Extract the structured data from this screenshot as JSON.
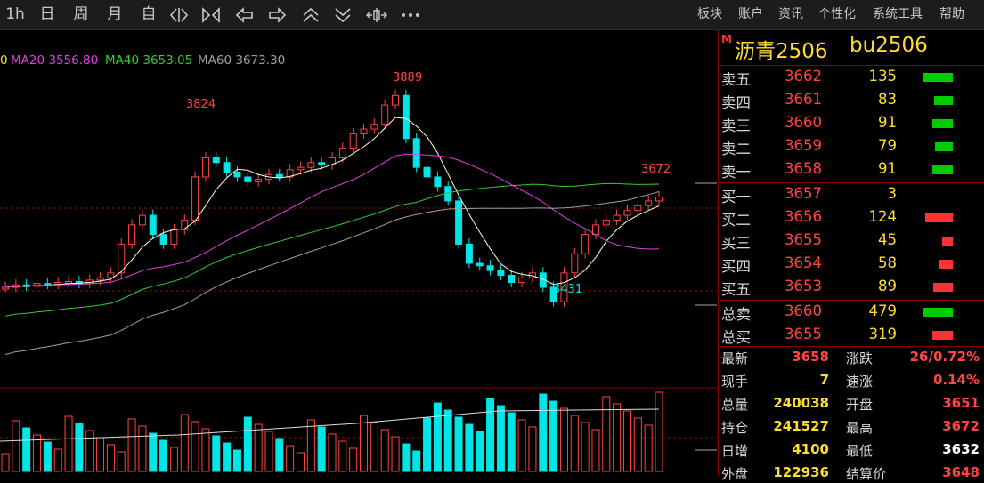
{
  "toolbar": {
    "period_buttons": [
      "1h",
      "日",
      "周",
      "月",
      "自"
    ],
    "menu": [
      "板块",
      "账户",
      "资讯",
      "个性化",
      "系统工具",
      "帮助"
    ]
  },
  "ma_legend": [
    {
      "text": "MA20 3556.80",
      "color": "#e040e0"
    },
    {
      "text": "MA40 3653.05",
      "color": "#33cc33"
    },
    {
      "text": "MA60 3673.30",
      "color": "#a0a0a0"
    }
  ],
  "chart_labels": {
    "high_1": "3824",
    "high_2": "3889",
    "last_high": "3672",
    "low": "3431"
  },
  "colors": {
    "up": "#ff4444",
    "down": "#00e5e5",
    "sell_bar": "#00cc00",
    "buy_bar": "#ff3333"
  },
  "panel": {
    "m_badge": "M",
    "contract_name": "沥青2506",
    "contract_code": "bu2506",
    "asks": [
      {
        "label": "卖五",
        "price": "3662",
        "vol": "135",
        "bar": 0.95
      },
      {
        "label": "卖四",
        "price": "3661",
        "vol": "83",
        "bar": 0.58
      },
      {
        "label": "卖三",
        "price": "3660",
        "vol": "91",
        "bar": 0.63
      },
      {
        "label": "卖二",
        "price": "3659",
        "vol": "79",
        "bar": 0.55
      },
      {
        "label": "卖一",
        "price": "3658",
        "vol": "91",
        "bar": 0.63
      }
    ],
    "bids": [
      {
        "label": "买一",
        "price": "3657",
        "vol": "3",
        "bar": 0.0
      },
      {
        "label": "买二",
        "price": "3656",
        "vol": "124",
        "bar": 0.87
      },
      {
        "label": "买三",
        "price": "3655",
        "vol": "45",
        "bar": 0.32
      },
      {
        "label": "买四",
        "price": "3654",
        "vol": "58",
        "bar": 0.41
      },
      {
        "label": "买五",
        "price": "3653",
        "vol": "89",
        "bar": 0.62
      }
    ],
    "totals": [
      {
        "label": "总卖",
        "price": "3660",
        "vol": "479",
        "bar": 0.95,
        "side": "sell"
      },
      {
        "label": "总买",
        "price": "3655",
        "vol": "319",
        "bar": 0.63,
        "side": "buy"
      }
    ],
    "stats_left": [
      {
        "label": "最新",
        "value": "3658",
        "color": "#ff4444"
      },
      {
        "label": "现手",
        "value": "7",
        "color": "#ffdd33"
      },
      {
        "label": "总量",
        "value": "240038",
        "color": "#ffdd33"
      },
      {
        "label": "持仓",
        "value": "241527",
        "color": "#ffdd33"
      },
      {
        "label": "日增",
        "value": "4100",
        "color": "#ffdd33"
      },
      {
        "label": "外盘",
        "value": "122936",
        "color": "#ffdd33"
      }
    ],
    "stats_right": [
      {
        "label": "涨跌",
        "value": "26/0.72%",
        "color": "#ff4444"
      },
      {
        "label": "速涨",
        "value": "0.14%",
        "color": "#ff4444"
      },
      {
        "label": "开盘",
        "value": "3651",
        "color": "#ff4444"
      },
      {
        "label": "最高",
        "value": "3672",
        "color": "#ff4444"
      },
      {
        "label": "最低",
        "value": "3632",
        "color": "#ffffff"
      },
      {
        "label": "结算价",
        "value": "3648",
        "color": "#ff4444"
      }
    ]
  }
}
